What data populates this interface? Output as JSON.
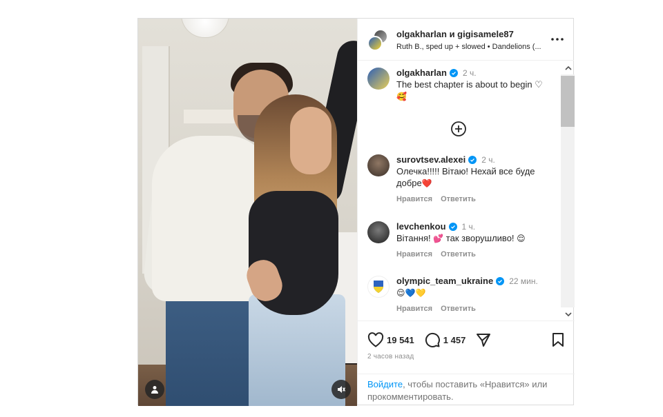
{
  "header": {
    "title": "olgakharlan и gigisamele87",
    "music": "Ruth B., sped up + slowed • Dandelions (..."
  },
  "caption": {
    "username": "olgakharlan",
    "time": "2 ч.",
    "text": "The best chapter is about to begin ♡",
    "emoji": "🥰"
  },
  "comments": [
    {
      "username": "surovtsev.alexei",
      "time": "2 ч.",
      "text": "Олечка!!!!! Вітаю! Нехай все буде добре",
      "emoji": "❤️",
      "like_label": "Нравится",
      "reply_label": "Ответить"
    },
    {
      "username": "levchenkou",
      "time": "1 ч.",
      "text": "Вітання! ",
      "emoji": "💕",
      "text2": " так зворушливо! ",
      "emoji2": "😌",
      "like_label": "Нравится",
      "reply_label": "Ответить"
    },
    {
      "username": "olympic_team_ukraine",
      "time": "22 мин.",
      "text": "",
      "emoji": "😌💙💛",
      "like_label": "Нравится",
      "reply_label": "Ответить"
    }
  ],
  "stats": {
    "likes": "19 541",
    "comments": "1 457",
    "posted": "2 часов назад"
  },
  "login_prompt": {
    "link": "Войдите",
    "rest": ", чтобы поставить «Нравится» или прокомментировать."
  },
  "icons": [
    "user-icon",
    "mute-icon",
    "more-icon",
    "add-circle-icon",
    "heart-icon",
    "comment-icon",
    "share-icon",
    "bookmark-icon",
    "verified-icon",
    "scroll-up-icon",
    "scroll-down-icon"
  ],
  "colors": {
    "link": "#0095f6",
    "verified": "#0095f6",
    "muted_text": "#8e8e8e"
  }
}
